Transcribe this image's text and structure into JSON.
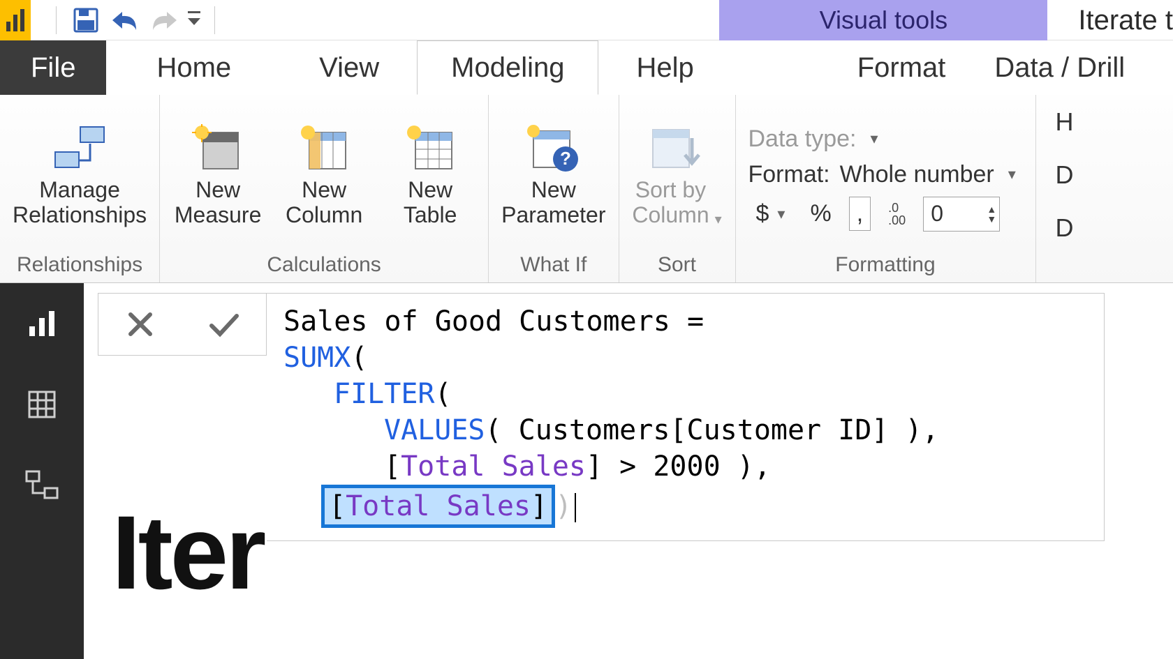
{
  "qat": {
    "logo_name": "powerbi-logo-icon"
  },
  "contextual_tab": "Visual tools",
  "window_title_partial": "Iterate t",
  "tabs": {
    "file": "File",
    "home": "Home",
    "view": "View",
    "modeling": "Modeling",
    "help": "Help",
    "format": "Format",
    "data_drill": "Data / Drill",
    "active": "modeling"
  },
  "ribbon": {
    "relationships": {
      "manage": "Manage\nRelationships",
      "group": "Relationships"
    },
    "calculations": {
      "measure": "New\nMeasure",
      "column": "New\nColumn",
      "table": "New\nTable",
      "group": "Calculations"
    },
    "whatif": {
      "parameter": "New\nParameter",
      "group": "What If"
    },
    "sort": {
      "sortby": "Sort by\nColumn",
      "group": "Sort"
    },
    "formatting": {
      "datatype_label": "Data type:",
      "format_label": "Format: ",
      "format_value": "Whole number",
      "currency": "$",
      "percent": "%",
      "thousands": ",",
      "decimal_icon": ".0\n.00",
      "decimal_value": "0",
      "group": "Formatting",
      "trailing1": "H",
      "trailing2": "D",
      "trailing3": "D"
    }
  },
  "formula": {
    "line1_a": "Sales of Good Customers = ",
    "line2_fn": "SUMX",
    "line2_b": "(",
    "line3_fn": "FILTER",
    "line3_b": "(",
    "line4_fn": "VALUES",
    "line4_b": "( Customers[Customer ID] ),",
    "line5_a": "[",
    "line5_meas": "Total Sales",
    "line5_b": "] > 2000 ),",
    "line6_a": "[",
    "line6_meas": "Total Sales",
    "line6_b": "]",
    "line6_c": ")"
  },
  "canvas": {
    "watermark": "Iter"
  }
}
